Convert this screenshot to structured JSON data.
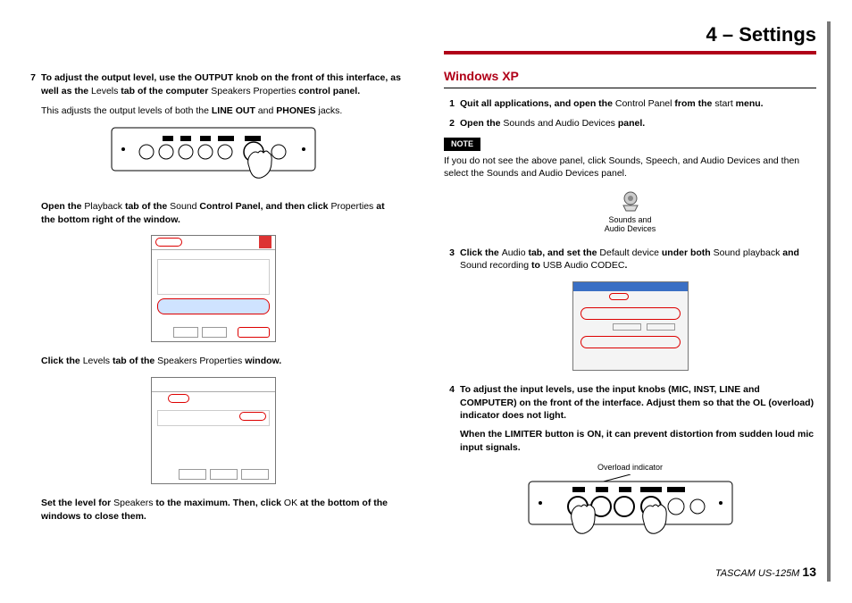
{
  "header": {
    "title": "4 – Settings"
  },
  "left": {
    "step7": {
      "n": "7",
      "l1": "To adjust the output level, use the OUTPUT knob on the front of this interface, as well as the ",
      "l1r": "Levels",
      "l2": " tab of the computer ",
      "l2r": "Speakers Properties",
      "l3": " control panel.",
      "sub1a": "This adjusts the output levels of both the ",
      "sub1b": "LINE OUT",
      "sub1c": " and ",
      "sub1d": "PHONES",
      "sub1e": " jacks."
    },
    "p2": {
      "a": "Open the ",
      "b": "Playback",
      "c": " tab of the ",
      "d": "Sound",
      "e": " Control Panel, and then click ",
      "f": "Properties",
      "g": " at the bottom right of the window."
    },
    "p3": {
      "a": "Click the ",
      "b": "Levels",
      "c": " tab of the ",
      "d": "Speakers Properties",
      "e": " window."
    },
    "p4": {
      "a": "Set the level for ",
      "b": "Speakers",
      "c": " to the maximum. Then, click ",
      "d": "OK",
      "e": " at the bottom of the windows to close them."
    }
  },
  "right": {
    "section": "Windows XP",
    "s1": {
      "n": "1",
      "a": "Quit all applications, and open the ",
      "b": "Control Panel",
      "c": " from the ",
      "d": "start",
      "e": " menu."
    },
    "s2": {
      "n": "2",
      "a": "Open the ",
      "b": "Sounds and Audio Devices",
      "c": " panel."
    },
    "note": "NOTE",
    "noteBody": {
      "a": "If you do not see the above panel, click ",
      "b": "Sounds, Speech, and Audio Devices",
      "c": " and then select the ",
      "d": "Sounds and Audio Devices",
      "e": " panel."
    },
    "iconLabel1": "Sounds and",
    "iconLabel2": "Audio Devices",
    "s3": {
      "n": "3",
      "a": "Click the ",
      "b": "Audio",
      "c": " tab, and set the ",
      "d": "Default device",
      "e": " under both ",
      "f": "Sound playback",
      "g": " and ",
      "h": "Sound recording",
      "i": " to ",
      "j": "USB Audio CODEC",
      "k": "."
    },
    "s4": {
      "n": "4",
      "a": "To adjust the input levels, use the input knobs (MIC, INST, LINE and COMPUTER) on the front of the interface. Adjust them so that the OL (overload) indicator does not light.",
      "b": "When the LIMITER button is ON, it can prevent distortion from sudden loud mic input signals."
    },
    "olCaption": "Overload indicator"
  },
  "footer": {
    "product": "TASCAM US-125M",
    "page": "13"
  }
}
